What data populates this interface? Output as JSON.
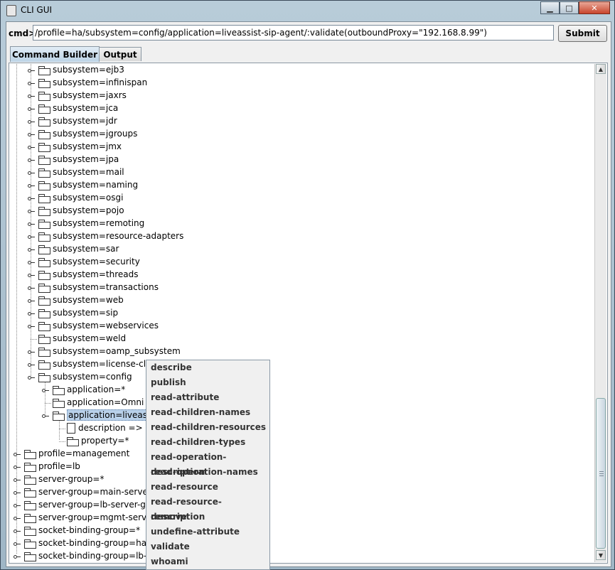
{
  "window": {
    "title": "CLI GUI"
  },
  "command": {
    "label": "cmd>",
    "value": "/profile=ha/subsystem=config/application=liveassist-sip-agent/:validate(outboundProxy=\"192.168.8.99\")",
    "submit_label": "Submit"
  },
  "tabs": [
    {
      "label": "Command Builder",
      "active": true
    },
    {
      "label": "Output",
      "active": false
    }
  ],
  "tree": {
    "subsystems": [
      {
        "label": "subsystem=ejb3"
      },
      {
        "label": "subsystem=infinispan"
      },
      {
        "label": "subsystem=jaxrs"
      },
      {
        "label": "subsystem=jca"
      },
      {
        "label": "subsystem=jdr"
      },
      {
        "label": "subsystem=jgroups"
      },
      {
        "label": "subsystem=jmx"
      },
      {
        "label": "subsystem=jpa"
      },
      {
        "label": "subsystem=mail"
      },
      {
        "label": "subsystem=naming"
      },
      {
        "label": "subsystem=osgi"
      },
      {
        "label": "subsystem=pojo"
      },
      {
        "label": "subsystem=remoting"
      },
      {
        "label": "subsystem=resource-adapters"
      },
      {
        "label": "subsystem=sar"
      },
      {
        "label": "subsystem=security"
      },
      {
        "label": "subsystem=threads"
      },
      {
        "label": "subsystem=transactions"
      },
      {
        "label": "subsystem=web"
      },
      {
        "label": "subsystem=sip"
      },
      {
        "label": "subsystem=webservices"
      },
      {
        "label": "subsystem=weld"
      },
      {
        "label": "subsystem=oamp_subsystem"
      },
      {
        "label": "subsystem=license-clie"
      },
      {
        "label": "subsystem=config"
      }
    ],
    "applications": [
      {
        "label": "application=*"
      },
      {
        "label": "application=Omni Ch"
      },
      {
        "label": "application=liveassis",
        "selected": true
      }
    ],
    "app_children": [
      {
        "label": "description => liv",
        "icon": "document-icon"
      },
      {
        "label": "property=*",
        "icon": "folder-icon"
      }
    ],
    "roots": [
      {
        "label": "profile=management"
      },
      {
        "label": "profile=lb"
      },
      {
        "label": "server-group=*"
      },
      {
        "label": "server-group=main-server-g"
      },
      {
        "label": "server-group=lb-server-grou"
      },
      {
        "label": "server-group=mgmt-server-"
      },
      {
        "label": "socket-binding-group=*"
      },
      {
        "label": "socket-binding-group=ha-so"
      },
      {
        "label": "socket-binding-group=lb-so"
      }
    ]
  },
  "context_menu": {
    "items": [
      "describe",
      "publish",
      "read-attribute",
      "read-children-names",
      "read-children-resources",
      "read-children-types",
      "read-operation-description",
      "read-operation-names",
      "read-resource",
      "read-resource-description",
      "remove",
      "undefine-attribute",
      "validate",
      "whoami"
    ]
  },
  "scrollbar": {
    "position_fraction": 0.72
  }
}
